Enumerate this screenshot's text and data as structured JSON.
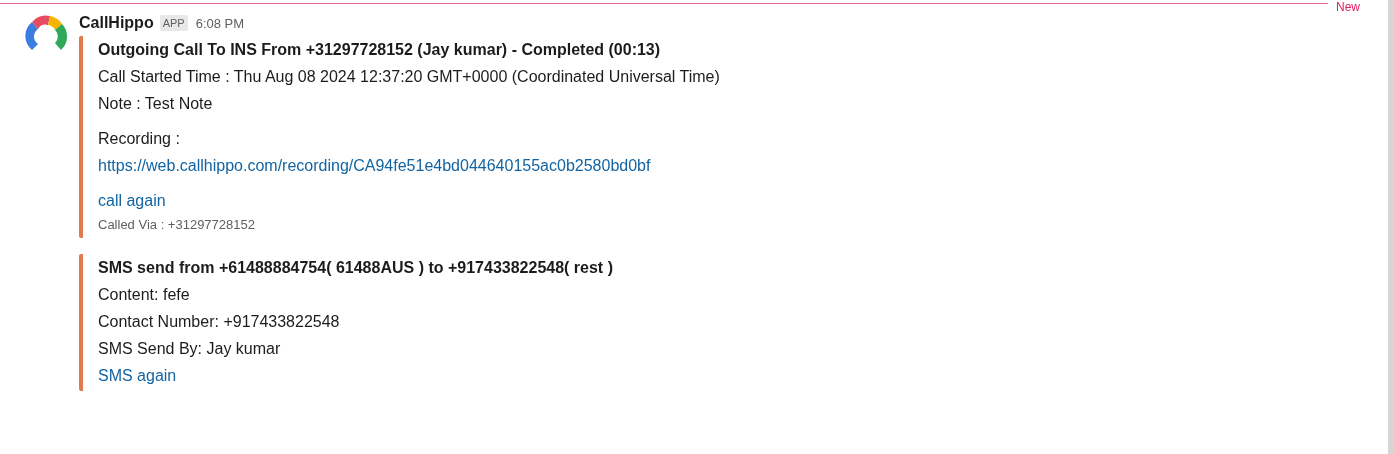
{
  "divider": {
    "label": "New"
  },
  "message": {
    "sender": "CallHippo",
    "badge": "APP",
    "time": "6:08 PM",
    "attachments": [
      {
        "lines": [
          {
            "kind": "title",
            "text": "Outgoing Call To INS From +31297728152 (Jay kumar)  - Completed (00:13)"
          },
          {
            "kind": "text",
            "text": "Call Started Time : Thu Aug 08 2024 12:37:20 GMT+0000 (Coordinated Universal Time)"
          },
          {
            "kind": "text",
            "text": "Note : Test Note"
          },
          {
            "kind": "label",
            "text": "Recording :"
          },
          {
            "kind": "link",
            "text": "https://web.callhippo.com/recording/CA94fe51e4bd044640155ac0b2580bd0bf"
          },
          {
            "kind": "action",
            "text": "call again"
          },
          {
            "kind": "footer",
            "text": "Called Via : +31297728152"
          }
        ]
      },
      {
        "lines": [
          {
            "kind": "title",
            "text": "SMS send from +61488884754( 61488AUS  ) to +917433822548( rest )"
          },
          {
            "kind": "text",
            "text": "Content: fefe"
          },
          {
            "kind": "text",
            "text": "Contact Number: +917433822548"
          },
          {
            "kind": "text",
            "text": "SMS Send By: Jay kumar"
          },
          {
            "kind": "link",
            "text": "SMS again"
          }
        ]
      }
    ]
  }
}
